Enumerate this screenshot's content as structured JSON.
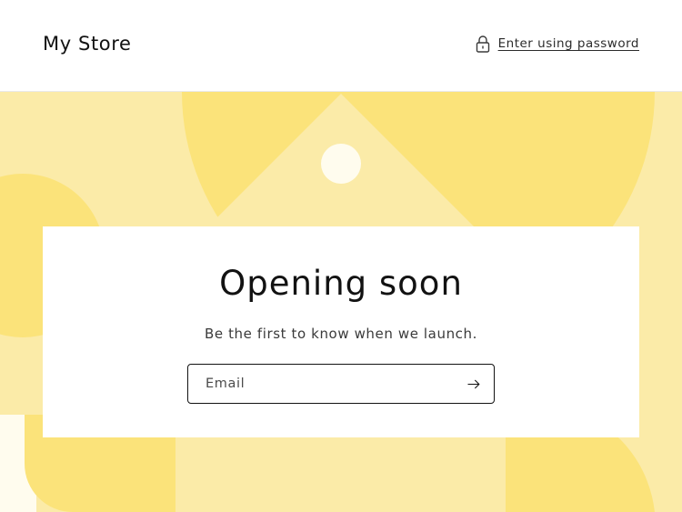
{
  "header": {
    "store_name": "My Store",
    "password_link_label": "Enter using password",
    "password_icon": "lock-icon"
  },
  "newsletter": {
    "title": "Opening soon",
    "subtitle": "Be the first to know when we launch.",
    "email_placeholder": "Email",
    "email_value": "",
    "submit_icon": "arrow-right-icon"
  },
  "colors": {
    "background": "#ffffff",
    "banner_light": "#fbeba8",
    "banner_medium": "#fbe37a",
    "banner_dot": "#fffcee",
    "text": "#121212",
    "border": "#121212"
  }
}
